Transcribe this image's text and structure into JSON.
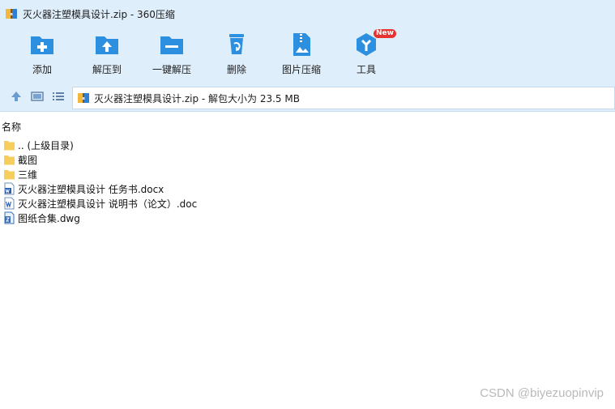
{
  "window": {
    "title": "灭火器注塑模具设计.zip - 360压缩",
    "app_icon": "archive-icon"
  },
  "toolbar": {
    "items": [
      {
        "label": "添加",
        "icon": "add-folder-icon"
      },
      {
        "label": "解压到",
        "icon": "extract-to-icon"
      },
      {
        "label": "一键解压",
        "icon": "one-click-extract-icon"
      },
      {
        "label": "删除",
        "icon": "recycle-bin-icon"
      },
      {
        "label": "图片压缩",
        "icon": "image-compress-icon"
      },
      {
        "label": "工具",
        "icon": "tools-icon",
        "badge": "New"
      }
    ]
  },
  "nav": {
    "path_text": "灭火器注塑模具设计.zip - 解包大小为 23.5 MB",
    "buttons": [
      "up-arrow-icon",
      "thumbnail-view-icon",
      "list-view-icon"
    ]
  },
  "filelist": {
    "header": "名称",
    "rows": [
      {
        "name": ".. (上级目录)",
        "icon": "folder-icon"
      },
      {
        "name": "截图",
        "icon": "folder-icon"
      },
      {
        "name": "三维",
        "icon": "folder-icon"
      },
      {
        "name": "灭火器注塑模具设计 任务书.docx",
        "icon": "word-doc-icon"
      },
      {
        "name": "灭火器注塑模具设计 说明书（论文）.doc",
        "icon": "word-doc-icon"
      },
      {
        "name": "图纸合集.dwg",
        "icon": "dwg-file-icon"
      }
    ]
  },
  "watermark": "CSDN @biyezuopinvip",
  "colors": {
    "chrome": "#dfeefb",
    "accent": "#2d8fe0",
    "badge": "#e8322f",
    "folder": "#f7cd5c"
  }
}
